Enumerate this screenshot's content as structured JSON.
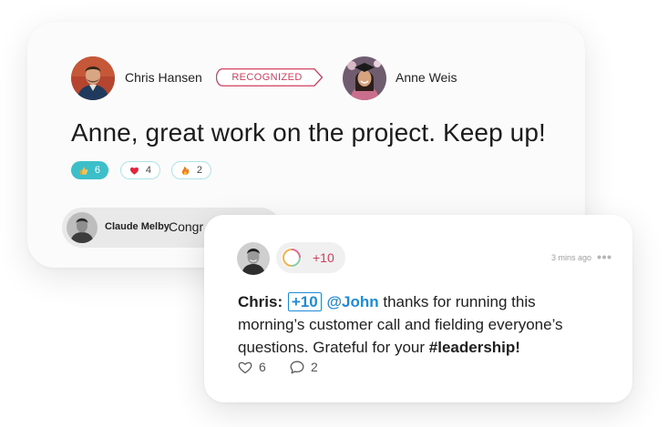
{
  "recognition": {
    "sender_name": "Chris Hansen",
    "badge_label": "RECOGNIZED",
    "recipient_name": "Anne Weis",
    "message": "Anne, great work on the project. Keep up!",
    "reactions": [
      {
        "icon": "thumbs-up-icon",
        "count": "6"
      },
      {
        "icon": "heart-icon",
        "count": "4"
      },
      {
        "icon": "fire-icon",
        "count": "2"
      }
    ],
    "comment": {
      "author": "Claude Melby",
      "text": "Congr"
    }
  },
  "post": {
    "points": "+10",
    "time": "3 mins ago",
    "body": {
      "author": "Chris:",
      "points_tag": "+10",
      "mention": "@John",
      "text_before_hashtag": " thanks for running this morning’s customer call and fielding everyone’s questions. Grateful for your ",
      "hashtag": "#leadership!"
    },
    "likes": "6",
    "comments": "2"
  },
  "colors": {
    "accent_red": "#d23c5d",
    "accent_teal": "#3dbfc9",
    "link_blue": "#1f8bd6"
  }
}
